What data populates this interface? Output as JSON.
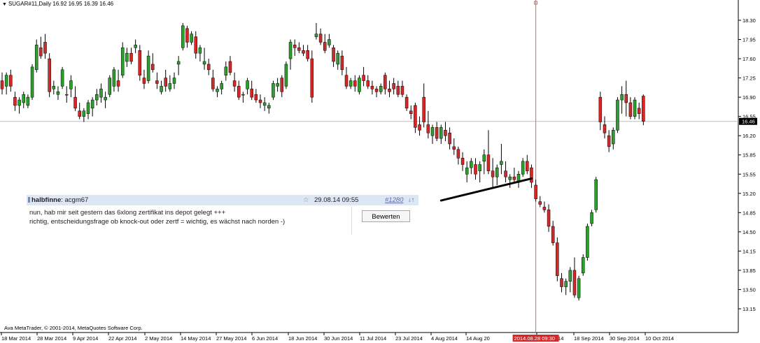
{
  "symbol_header": "SUGAR#11,Daily  16.92 16.95 16.39 16.46",
  "copyright": "Ava MetaTrader, © 2001-2014, MetaQuotes Software Corp.",
  "current_price_label": "16.46",
  "cursor_date_label": "2014.08.28 09:30",
  "comment": {
    "user": "halbfinne",
    "user_suffix": ": acgm67",
    "star": "☆",
    "date": "29.08.14 09:55",
    "post_number": "#1280",
    "arrows": "↓↑",
    "line1": "nun, hab mir seit gestern das 6xlong zertifikat ins depot gelegt +++",
    "line2": "richtig, entscheidungsfrage ob knock-out oder zertf = wichtig, es wächst nach norden -)",
    "button_label": "Bewerten"
  },
  "colors": {
    "bull": "#2ca02c",
    "bear": "#d62728",
    "wick": "#000000",
    "cursor_line": "#e46464",
    "price_line": "#bdbdbd",
    "cursor_label_bg": "#d62728",
    "price_label_bg": "#000000",
    "annotation_line": "#000000"
  },
  "chart_data": {
    "type": "candlestick",
    "title": "SUGAR#11,Daily",
    "last_bar": {
      "open": 16.92,
      "high": 16.95,
      "low": 16.39,
      "close": 16.46
    },
    "ylim": [
      13.05,
      18.55
    ],
    "y_ticks": [
      "18.30",
      "17.95",
      "17.60",
      "17.25",
      "16.90",
      "16.55",
      "16.20",
      "15.85",
      "15.55",
      "15.20",
      "14.85",
      "14.50",
      "14.15",
      "13.85",
      "13.50",
      "13.15"
    ],
    "x_ticks": [
      "18 Mar 2014",
      "28 Mar 2014",
      "9 Apr 2014",
      "22 Apr 2014",
      "2 May 2014",
      "14 May 2014",
      "27 May 2014",
      "6 Jun 2014",
      "18 Jun 2014",
      "30 Jun 2014",
      "11 Jul 2014",
      "23 Jul 2014",
      "4 Aug 2014",
      "14 Aug 20",
      "8 Sep 2014",
      "18 Sep 2014",
      "30 Sep 2014",
      "10 Oct 2014"
    ],
    "current_price": 16.46,
    "cursor_bar_index": 124,
    "annotation_line": {
      "from": {
        "index": 102,
        "price": 15.07
      },
      "to": {
        "index": 123,
        "price": 15.47
      }
    },
    "candles": [
      [
        17.2,
        17.35,
        16.95,
        17.05
      ],
      [
        17.1,
        17.35,
        16.95,
        17.3
      ],
      [
        17.3,
        17.4,
        17.0,
        17.1
      ],
      [
        16.9,
        17.0,
        16.65,
        16.75
      ],
      [
        16.75,
        16.9,
        16.6,
        16.85
      ],
      [
        16.8,
        17.0,
        16.7,
        16.95
      ],
      [
        16.75,
        16.95,
        16.7,
        16.9
      ],
      [
        16.9,
        17.5,
        16.85,
        17.45
      ],
      [
        17.4,
        17.95,
        17.35,
        17.85
      ],
      [
        17.8,
        18.0,
        17.6,
        17.65
      ],
      [
        17.9,
        18.05,
        17.6,
        17.7
      ],
      [
        17.6,
        17.7,
        16.9,
        17.0
      ],
      [
        17.05,
        17.2,
        16.95,
        17.1
      ],
      [
        16.95,
        17.1,
        16.85,
        17.0
      ],
      [
        17.1,
        17.45,
        17.05,
        17.4
      ],
      [
        16.95,
        17.1,
        16.8,
        16.95
      ],
      [
        17.05,
        17.3,
        16.9,
        17.2
      ],
      [
        16.9,
        17.1,
        16.65,
        16.7
      ],
      [
        16.65,
        16.8,
        16.5,
        16.55
      ],
      [
        16.55,
        16.7,
        16.45,
        16.65
      ],
      [
        16.6,
        16.85,
        16.5,
        16.8
      ],
      [
        16.7,
        16.9,
        16.55,
        16.85
      ],
      [
        16.85,
        17.05,
        16.75,
        16.95
      ],
      [
        16.9,
        17.15,
        16.8,
        17.05
      ],
      [
        16.85,
        17.0,
        16.7,
        16.9
      ],
      [
        16.95,
        17.3,
        16.9,
        17.25
      ],
      [
        17.1,
        17.45,
        17.0,
        17.4
      ],
      [
        17.2,
        17.4,
        17.0,
        17.1
      ],
      [
        17.3,
        17.9,
        17.25,
        17.8
      ],
      [
        17.55,
        17.8,
        17.45,
        17.7
      ],
      [
        17.7,
        17.8,
        17.5,
        17.55
      ],
      [
        17.8,
        17.95,
        17.7,
        17.85
      ],
      [
        17.75,
        17.85,
        17.2,
        17.3
      ],
      [
        17.25,
        17.4,
        17.05,
        17.15
      ],
      [
        17.2,
        17.75,
        17.15,
        17.65
      ],
      [
        17.5,
        17.7,
        17.35,
        17.4
      ],
      [
        17.2,
        17.35,
        17.05,
        17.15
      ],
      [
        17.0,
        17.2,
        16.95,
        17.1
      ],
      [
        17.25,
        17.4,
        17.0,
        17.1
      ],
      [
        17.05,
        17.3,
        17.0,
        17.15
      ],
      [
        17.15,
        17.35,
        17.05,
        17.25
      ],
      [
        17.5,
        17.65,
        17.3,
        17.55
      ],
      [
        17.8,
        18.25,
        17.75,
        18.2
      ],
      [
        18.15,
        18.2,
        17.8,
        17.9
      ],
      [
        17.9,
        18.1,
        17.85,
        18.05
      ],
      [
        18.0,
        18.1,
        17.6,
        17.7
      ],
      [
        17.7,
        17.85,
        17.55,
        17.8
      ],
      [
        17.5,
        17.8,
        17.4,
        17.55
      ],
      [
        17.5,
        17.6,
        17.3,
        17.4
      ],
      [
        17.25,
        17.4,
        17.0,
        17.05
      ],
      [
        17.0,
        17.1,
        16.9,
        17.05
      ],
      [
        17.05,
        17.2,
        16.95,
        17.15
      ],
      [
        17.3,
        17.55,
        17.2,
        17.45
      ],
      [
        17.55,
        17.65,
        17.3,
        17.35
      ],
      [
        17.2,
        17.35,
        17.0,
        17.1
      ],
      [
        17.1,
        17.2,
        16.85,
        16.9
      ],
      [
        16.95,
        17.0,
        16.8,
        16.95
      ],
      [
        17.05,
        17.25,
        16.95,
        17.2
      ],
      [
        17.05,
        17.2,
        16.85,
        16.9
      ],
      [
        16.95,
        17.05,
        16.8,
        16.85
      ],
      [
        16.85,
        16.95,
        16.7,
        16.8
      ],
      [
        16.75,
        16.9,
        16.65,
        16.8
      ],
      [
        16.7,
        16.8,
        16.6,
        16.75
      ],
      [
        16.9,
        17.2,
        16.85,
        17.15
      ],
      [
        17.1,
        17.25,
        17.0,
        17.15
      ],
      [
        17.25,
        17.3,
        16.9,
        17.0
      ],
      [
        17.1,
        17.55,
        17.05,
        17.5
      ],
      [
        17.6,
        17.95,
        17.4,
        17.9
      ],
      [
        17.85,
        17.95,
        17.65,
        17.8
      ],
      [
        17.8,
        17.9,
        17.7,
        17.75
      ],
      [
        17.75,
        17.85,
        17.65,
        17.7
      ],
      [
        17.75,
        17.85,
        17.55,
        17.6
      ],
      [
        17.6,
        17.75,
        16.8,
        16.9
      ],
      [
        18.0,
        18.25,
        17.95,
        18.05
      ],
      [
        18.05,
        18.15,
        17.85,
        17.9
      ],
      [
        17.9,
        18.05,
        17.7,
        17.75
      ],
      [
        17.85,
        18.05,
        17.8,
        17.95
      ],
      [
        17.8,
        17.85,
        17.45,
        17.55
      ],
      [
        17.5,
        17.75,
        17.4,
        17.7
      ],
      [
        17.65,
        17.75,
        17.3,
        17.4
      ],
      [
        17.3,
        17.45,
        17.05,
        17.1
      ],
      [
        17.1,
        17.25,
        17.05,
        17.2
      ],
      [
        17.2,
        17.3,
        17.0,
        17.1
      ],
      [
        17.0,
        17.3,
        16.95,
        17.25
      ],
      [
        17.3,
        17.45,
        17.1,
        17.2
      ],
      [
        17.2,
        17.3,
        17.05,
        17.1
      ],
      [
        17.1,
        17.2,
        16.95,
        17.05
      ],
      [
        17.05,
        17.1,
        16.9,
        17.0
      ],
      [
        17.0,
        17.15,
        16.95,
        17.1
      ],
      [
        17.3,
        17.35,
        16.95,
        17.05
      ],
      [
        17.05,
        17.2,
        16.9,
        17.0
      ],
      [
        17.15,
        17.25,
        16.95,
        17.05
      ],
      [
        17.1,
        17.2,
        16.9,
        16.95
      ],
      [
        17.1,
        17.2,
        16.9,
        16.95
      ],
      [
        16.9,
        16.95,
        16.65,
        16.7
      ],
      [
        16.65,
        16.75,
        16.5,
        16.6
      ],
      [
        16.75,
        16.8,
        16.25,
        16.35
      ],
      [
        16.4,
        16.55,
        16.2,
        16.3
      ],
      [
        16.9,
        17.15,
        16.35,
        16.45
      ],
      [
        16.4,
        16.65,
        16.15,
        16.25
      ],
      [
        16.2,
        16.4,
        16.05,
        16.35
      ],
      [
        16.35,
        16.45,
        16.1,
        16.15
      ],
      [
        16.15,
        16.4,
        16.05,
        16.35
      ],
      [
        16.3,
        16.45,
        16.1,
        16.2
      ],
      [
        16.25,
        16.35,
        15.95,
        16.05
      ],
      [
        16.0,
        16.15,
        15.85,
        15.95
      ],
      [
        15.95,
        16.0,
        15.7,
        15.8
      ],
      [
        15.8,
        15.9,
        15.6,
        15.7
      ],
      [
        15.55,
        15.75,
        15.4,
        15.65
      ],
      [
        15.65,
        15.8,
        15.55,
        15.75
      ],
      [
        15.7,
        15.8,
        15.45,
        15.55
      ],
      [
        15.6,
        15.75,
        15.4,
        15.7
      ],
      [
        15.75,
        15.95,
        15.55,
        15.85
      ],
      [
        15.85,
        16.3,
        15.55,
        15.6
      ],
      [
        15.6,
        15.8,
        15.3,
        15.5
      ],
      [
        15.5,
        15.7,
        15.35,
        15.65
      ],
      [
        15.7,
        16.05,
        15.55,
        15.75
      ],
      [
        15.6,
        15.75,
        15.4,
        15.5
      ],
      [
        15.45,
        15.55,
        15.3,
        15.5
      ],
      [
        15.5,
        15.65,
        15.4,
        15.45
      ],
      [
        15.4,
        15.6,
        15.3,
        15.55
      ],
      [
        15.55,
        15.8,
        15.5,
        15.75
      ],
      [
        15.75,
        15.85,
        15.55,
        15.6
      ],
      [
        15.65,
        15.7,
        15.3,
        15.4
      ],
      [
        15.35,
        15.45,
        15.05,
        15.1
      ],
      [
        15.05,
        15.15,
        14.95,
        15.0
      ],
      [
        14.95,
        15.05,
        14.85,
        14.9
      ],
      [
        14.9,
        15.0,
        14.5,
        14.6
      ],
      [
        14.6,
        14.7,
        14.25,
        14.3
      ],
      [
        14.3,
        14.4,
        13.65,
        13.75
      ],
      [
        13.7,
        13.8,
        13.45,
        13.55
      ],
      [
        13.55,
        13.7,
        13.4,
        13.65
      ],
      [
        13.65,
        13.9,
        13.45,
        13.85
      ],
      [
        13.85,
        14.05,
        13.35,
        13.4
      ],
      [
        13.35,
        13.75,
        13.3,
        13.7
      ],
      [
        13.8,
        14.1,
        13.75,
        14.05
      ],
      [
        14.05,
        14.65,
        14.0,
        14.6
      ],
      [
        14.65,
        14.9,
        14.6,
        14.85
      ],
      [
        14.9,
        15.5,
        14.85,
        15.45
      ],
      [
        16.9,
        17.0,
        16.3,
        16.45
      ],
      [
        16.4,
        16.55,
        16.15,
        16.25
      ],
      [
        16.2,
        16.3,
        15.9,
        16.0
      ],
      [
        16.05,
        16.35,
        15.95,
        16.3
      ],
      [
        16.3,
        16.9,
        16.25,
        16.85
      ],
      [
        16.85,
        17.1,
        16.6,
        16.95
      ],
      [
        16.95,
        17.2,
        16.55,
        16.8
      ],
      [
        16.8,
        16.9,
        16.5,
        16.55
      ],
      [
        16.55,
        16.9,
        16.5,
        16.85
      ],
      [
        16.7,
        16.8,
        16.5,
        16.6
      ],
      [
        16.92,
        16.95,
        16.39,
        16.46
      ]
    ]
  }
}
